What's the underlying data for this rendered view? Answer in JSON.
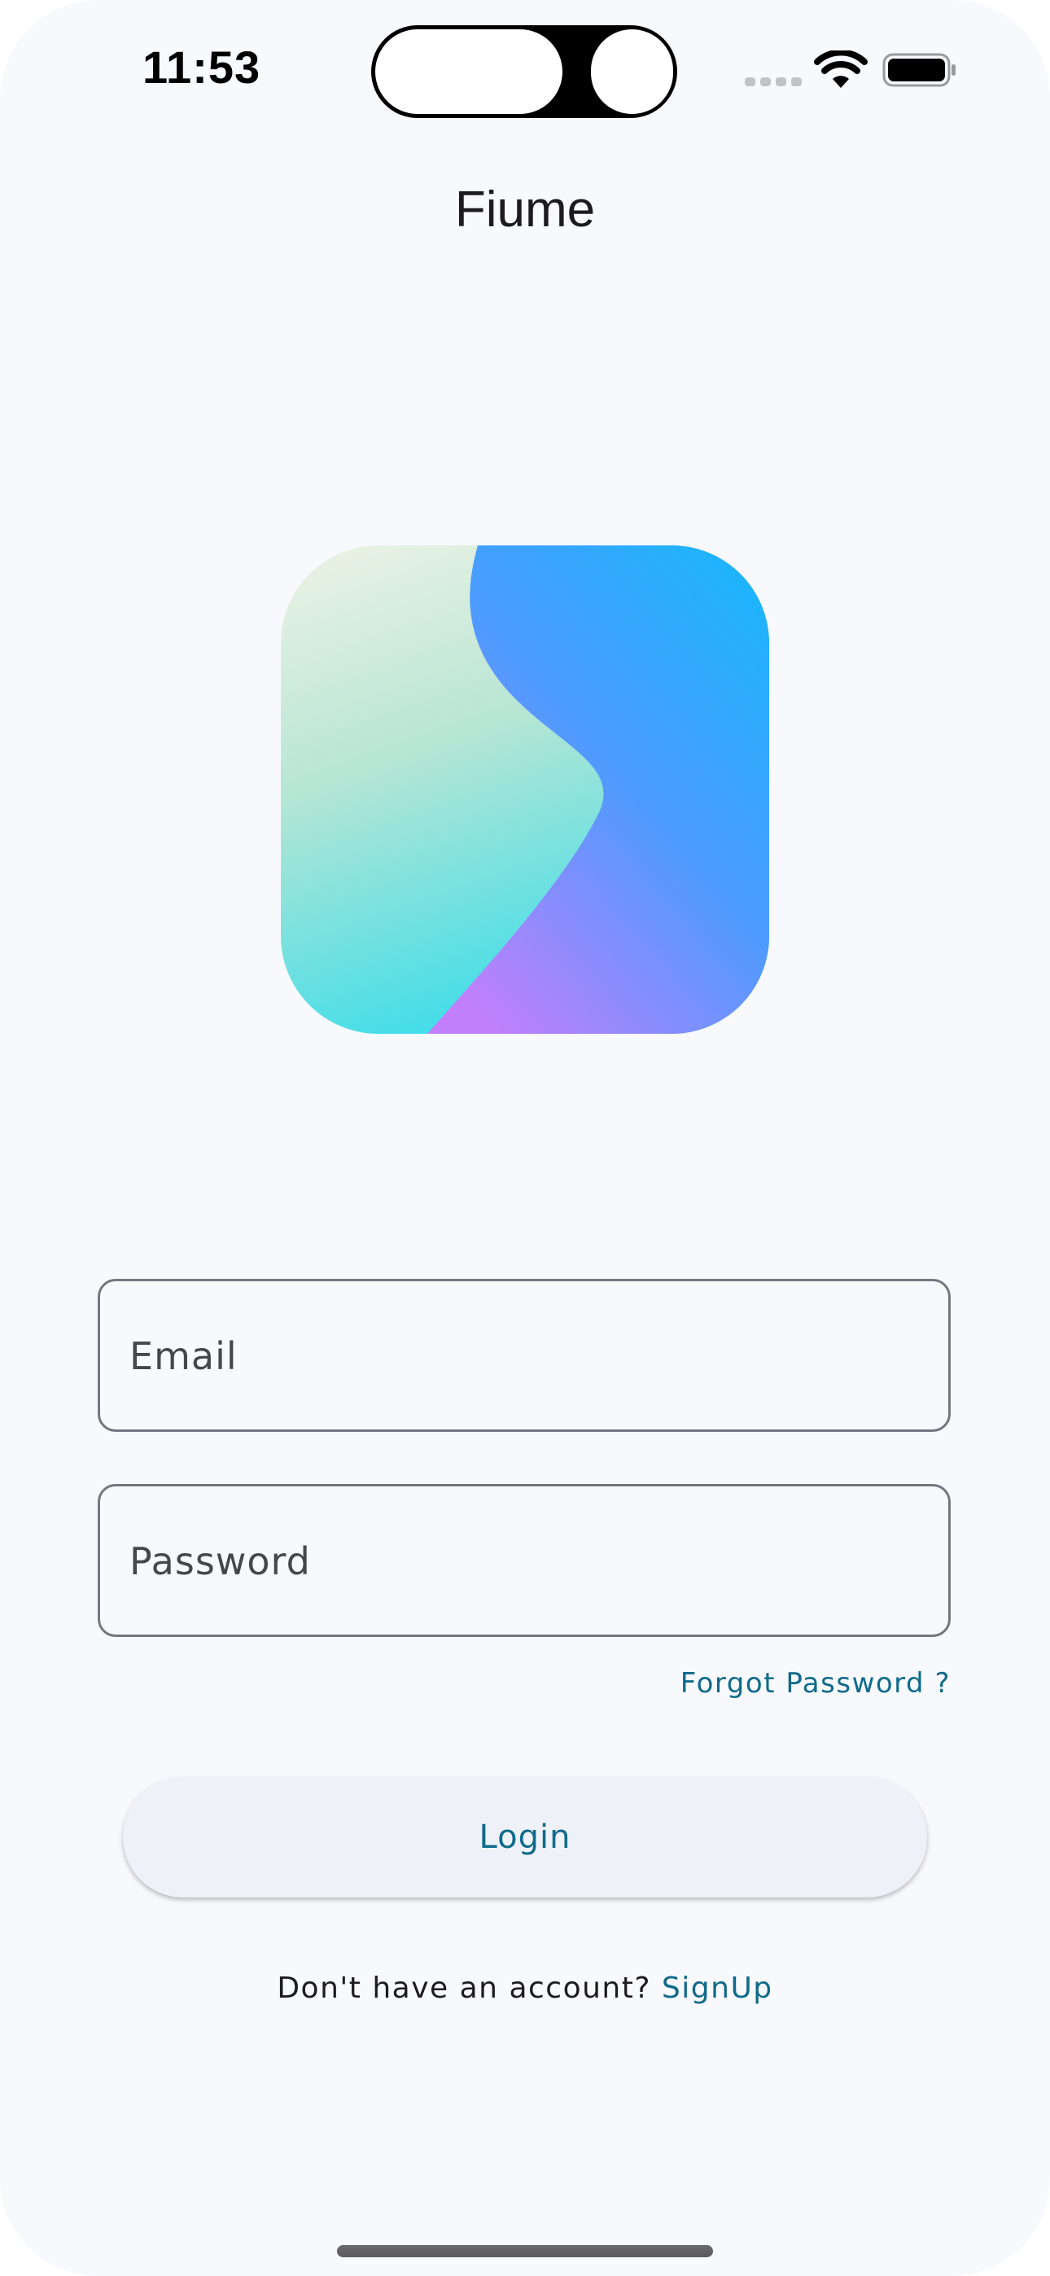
{
  "status_bar": {
    "time": "11:53",
    "signal_icon": "cellular-signal-icon",
    "wifi_icon": "wifi-icon",
    "battery_icon": "battery-icon"
  },
  "app": {
    "title": "Fiume",
    "logo_icon": "fiume-logo"
  },
  "form": {
    "email_placeholder": "Email",
    "email_value": "",
    "password_placeholder": "Password",
    "password_value": "",
    "forgot_password_label": "Forgot Password ?",
    "login_label": "Login",
    "signup_prompt": "Don't have an account?",
    "signup_label": "SignUp"
  },
  "colors": {
    "background": "#f8f9fd",
    "accent": "#106a8a",
    "button_background": "#eef2f8",
    "field_border": "#74777f"
  }
}
